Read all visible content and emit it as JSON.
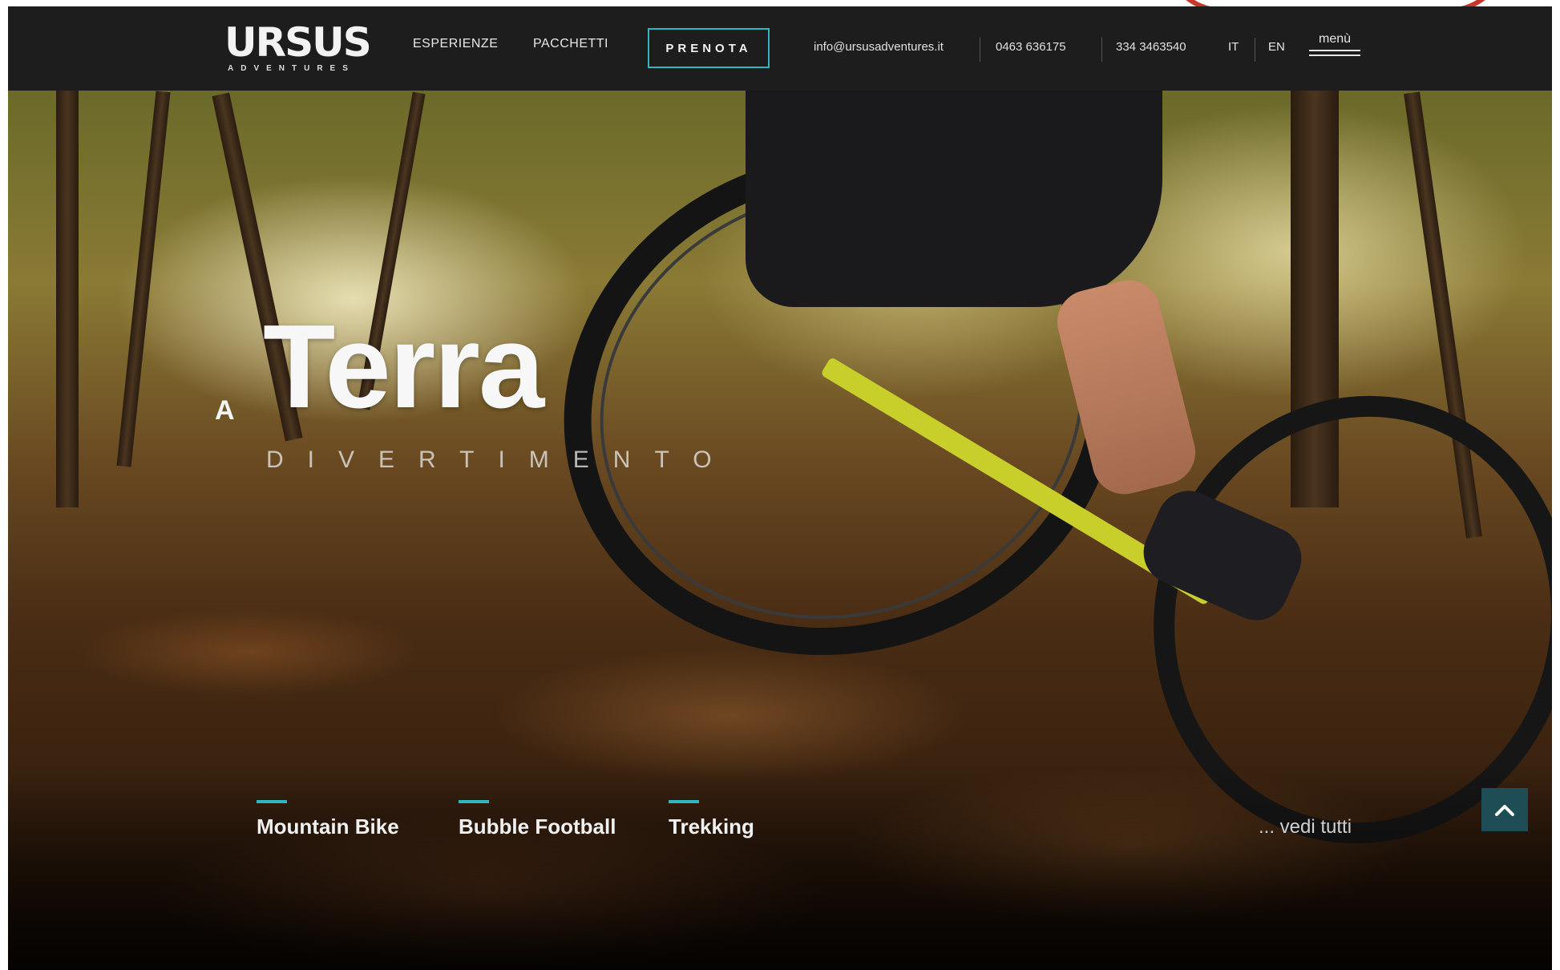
{
  "nav": {
    "logo": "URSUS",
    "logo_sub": "ADVENTURES",
    "links": [
      "ESPERIENZE",
      "PACCHETTI"
    ],
    "cta": "PRENOTA",
    "email": "info@ursusadventures.it",
    "phone1": "0463 636175",
    "phone2": "334 3463540",
    "lang_it": "IT",
    "lang_en": "EN",
    "menu": "menù"
  },
  "hero": {
    "prefix": "A",
    "title": "Terra",
    "subtitle": "DIVERTIMENTO"
  },
  "experiences": [
    {
      "label": "Mountain Bike"
    },
    {
      "label": "Bubble Football"
    },
    {
      "label": "Trekking"
    }
  ],
  "see_all": "... vedi tutti",
  "colors": {
    "accent": "#2fb6c0",
    "navbar": "#1d1d1d"
  },
  "icons": {
    "scroll_top": "chevron-up-icon"
  }
}
